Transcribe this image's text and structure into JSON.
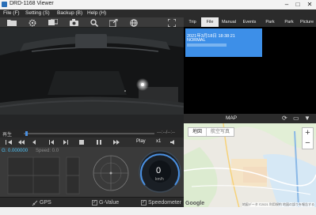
{
  "window": {
    "title": "DRD-1168 Viewer"
  },
  "menu": {
    "items": [
      "File (F)",
      "Setting (S)",
      "Backup (B)",
      "Help (H)"
    ]
  },
  "playback": {
    "label": "再生",
    "time": "---:--/--:--",
    "play_label": "Play",
    "speed": "x1"
  },
  "gauges": {
    "g_value": "G: 0.000000",
    "speed": "Speed: 0.0",
    "speedometer_value": "0",
    "speedometer_unit": "km/h"
  },
  "bottom_tabs": {
    "gps": "GPS",
    "gvalue": "G-Value",
    "speedometer": "Speedometer"
  },
  "tabs": [
    "Trip",
    "File",
    "Manual",
    "Events",
    "Park monitori",
    "Park event",
    "Picture"
  ],
  "file_list": [
    {
      "datetime": "2021年3月18日 18:38:21",
      "type": "NORMAL"
    }
  ],
  "map": {
    "title": "MAP",
    "type_map": "地図",
    "type_satellite": "航空写真",
    "zoom_in": "+",
    "zoom_out": "−",
    "logo": "Google",
    "attribution": "地図データ ©2021 利用規約 地図の誤りを報告する"
  }
}
